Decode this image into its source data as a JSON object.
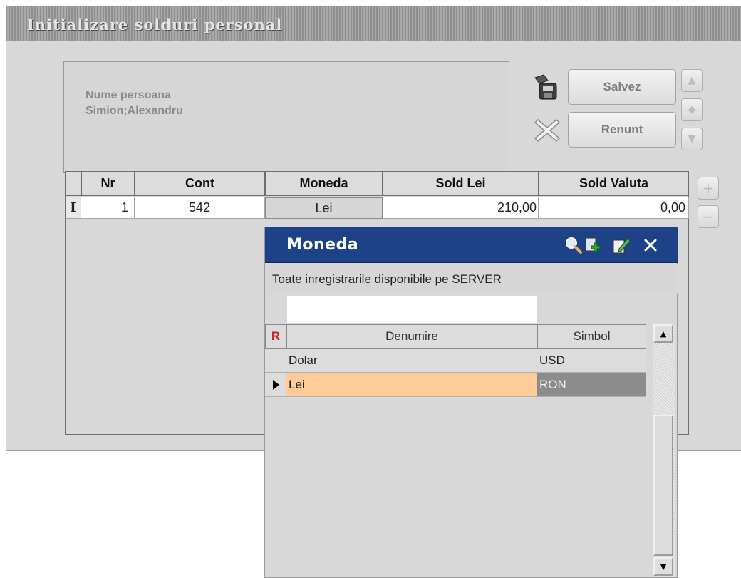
{
  "window": {
    "title": "Initializare solduri personal"
  },
  "person": {
    "label": "Nume persoana",
    "name": "Simion;Alexandru"
  },
  "toolbar": {
    "save_label": "Salvez",
    "cancel_label": "Renunt"
  },
  "side_buttons": {
    "up": "▲",
    "center": "◆",
    "down": "▼",
    "add": "+",
    "remove": "−"
  },
  "grid": {
    "columns": [
      "Nr",
      "Cont",
      "Moneda",
      "Sold Lei",
      "Sold Valuta"
    ],
    "rows": [
      {
        "indicator": "I",
        "nr": "1",
        "cont": "542",
        "moneda": "Lei",
        "sold_lei": "210,00",
        "sold_valuta": "0,00"
      }
    ]
  },
  "popup": {
    "title": "Moneda",
    "description": "Toate inregistrarile disponibile pe SERVER",
    "search": {
      "value": "",
      "placeholder": ""
    },
    "columns": {
      "marker": "R",
      "name": "Denumire",
      "symbol": "Simbol"
    },
    "rows": [
      {
        "name": "Dolar",
        "symbol": "USD",
        "selected": false
      },
      {
        "name": "Lei",
        "symbol": "RON",
        "selected": true
      }
    ],
    "icons": [
      "search-icon",
      "add-record-icon",
      "edit-icon",
      "close-icon"
    ]
  },
  "colors": {
    "popup_title": "#1d4287",
    "selected_row": "#ffcc99",
    "selected_symbol": "#8c8c8c"
  }
}
